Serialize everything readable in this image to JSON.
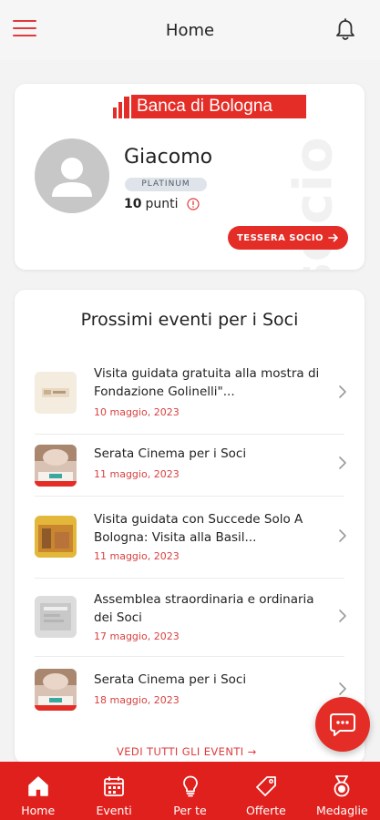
{
  "header": {
    "title": "Home",
    "menu_icon": "hamburger-icon",
    "notification_icon": "bell-icon"
  },
  "profile": {
    "bank_logo_text": "Banca di Bologna",
    "watermark": "socio",
    "name": "Giacomo",
    "tier": "PLATINUM",
    "points_value": "10",
    "points_label": "punti",
    "card_button": "TESSERA SOCIO"
  },
  "events": {
    "title": "Prossimi eventi per i Soci",
    "items": [
      {
        "title": "Visita guidata gratuita alla mostra di Fondazione Golinelli\"...",
        "date": "10 maggio, 2023"
      },
      {
        "title": "Serata Cinema per i Soci",
        "date": "11 maggio, 2023"
      },
      {
        "title": "Visita guidata con Succede Solo A Bologna: Visita alla Basil...",
        "date": "11 maggio, 2023"
      },
      {
        "title": "Assemblea straordinaria e ordinaria dei Soci",
        "date": "17 maggio, 2023"
      },
      {
        "title": "Serata Cinema per i Soci",
        "date": "18 maggio, 2023"
      }
    ],
    "see_all": "VEDI TUTTI GLI EVENTI"
  },
  "bottom_nav": [
    {
      "label": "Home",
      "icon": "home-icon"
    },
    {
      "label": "Eventi",
      "icon": "calendar-icon"
    },
    {
      "label": "Per te",
      "icon": "lightbulb-icon"
    },
    {
      "label": "Offerte",
      "icon": "tag-icon"
    },
    {
      "label": "Medaglie",
      "icon": "medal-icon"
    }
  ],
  "colors": {
    "brand_red": "#e52d27",
    "nav_red": "#e0201c",
    "date_red": "#d94040",
    "badge_bg": "#dfe3ea"
  }
}
